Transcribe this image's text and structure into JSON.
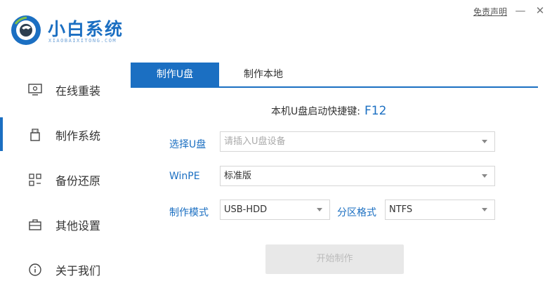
{
  "header": {
    "brand_name": "小白系统",
    "brand_sub": "XIAOBAIXITONG.COM",
    "disclaimer": "免责声明",
    "minimize_glyph": "—",
    "close_glyph": "✕"
  },
  "sidebar": {
    "items": [
      {
        "label": "在线重装",
        "icon": "monitor-icon",
        "active": false
      },
      {
        "label": "制作系统",
        "icon": "usb-drive-icon",
        "active": true
      },
      {
        "label": "备份还原",
        "icon": "grid-icon",
        "active": false
      },
      {
        "label": "其他设置",
        "icon": "briefcase-icon",
        "active": false
      },
      {
        "label": "关于我们",
        "icon": "info-icon",
        "active": false
      }
    ]
  },
  "tabs": [
    {
      "label": "制作U盘",
      "active": true
    },
    {
      "label": "制作本地",
      "active": false
    }
  ],
  "form": {
    "hotkey_label": "本机U盘启动快捷键:",
    "hotkey_value": "F12",
    "usb_label": "选择U盘",
    "usb_placeholder": "请插入U盘设备",
    "winpe_label": "WinPE",
    "winpe_value": "标准版",
    "mode_label": "制作模式",
    "mode_value": "USB-HDD",
    "partition_label": "分区格式",
    "partition_value": "NTFS",
    "start_button": "开始制作"
  },
  "colors": {
    "accent": "#1b6fc2",
    "disabled_bg": "#e8e8e8",
    "disabled_text": "#bbbbbb"
  }
}
